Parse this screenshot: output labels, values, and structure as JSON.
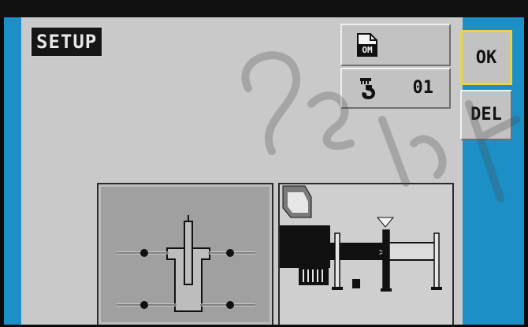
{
  "screen": {
    "title": "SETUP"
  },
  "buttons": {
    "ok_label": "OK",
    "del_label": "DEL",
    "mode_icon": "om-document-icon",
    "mode_icon_text": "OM",
    "hook_icon": "crane-hook-icon",
    "hook_value": "01"
  },
  "diagrams": {
    "outrigger": "outrigger-layout-diagram",
    "side": "crane-side-view-diagram"
  },
  "colors": {
    "screen_background": "#1c8fc7",
    "panel": "#c9c9c9",
    "ok_highlight": "#e8d447"
  }
}
